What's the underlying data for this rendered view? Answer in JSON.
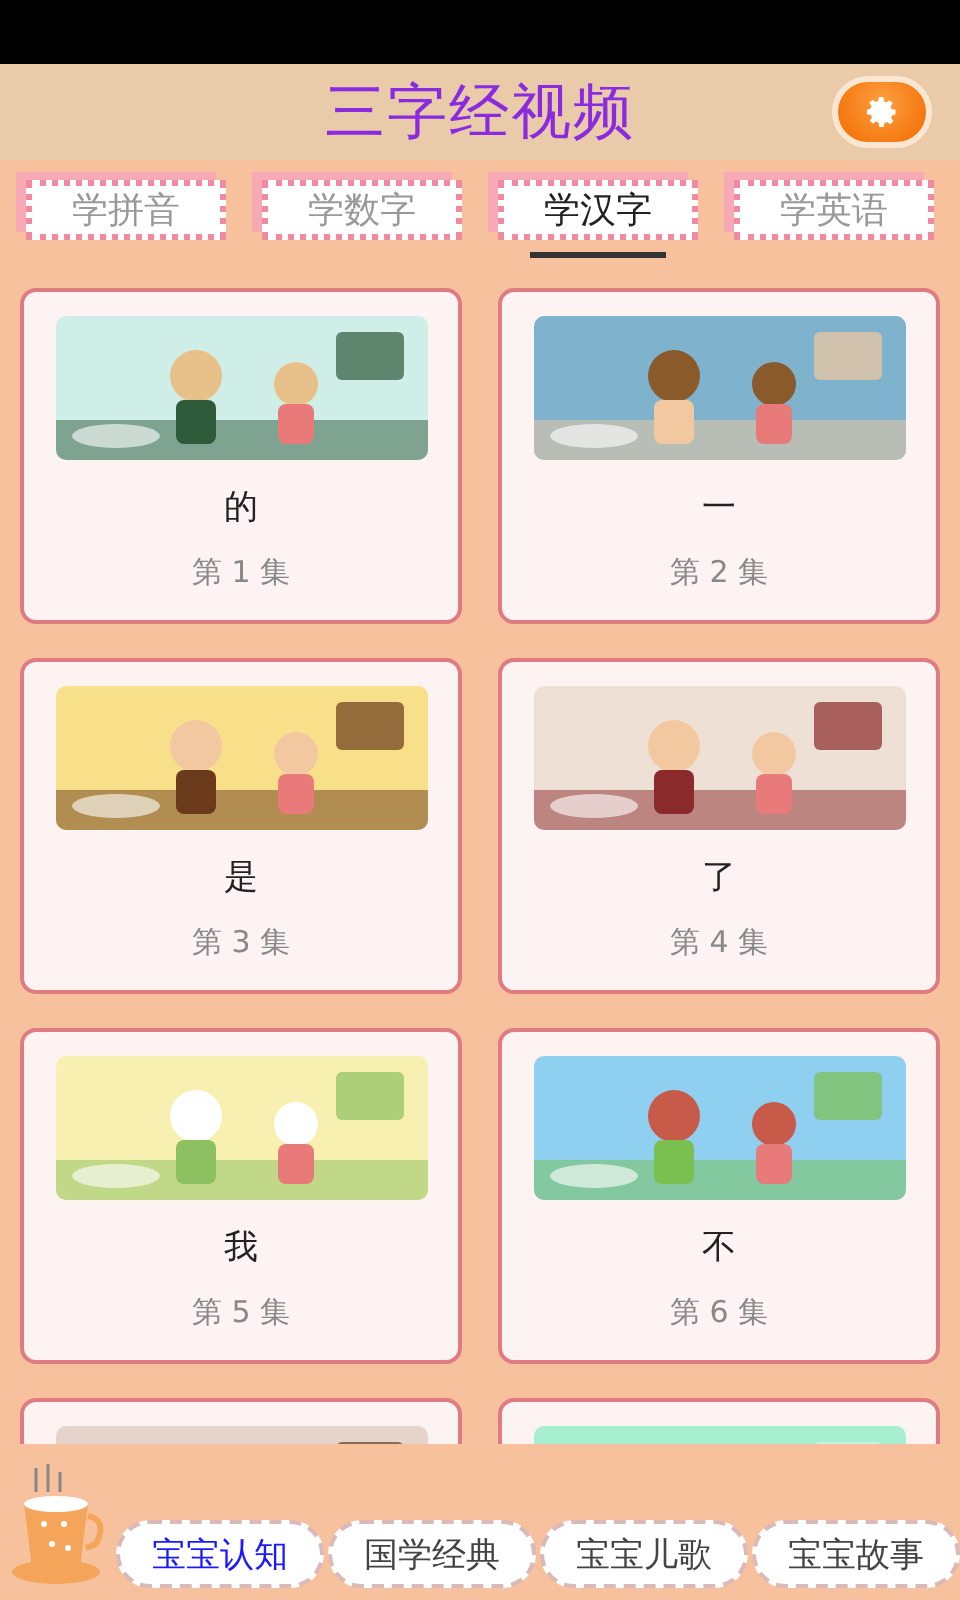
{
  "header": {
    "title": "三字经视频"
  },
  "tabs": [
    {
      "label": "学拼音",
      "selected": false
    },
    {
      "label": "学数字",
      "selected": false
    },
    {
      "label": "学汉字",
      "selected": true
    },
    {
      "label": "学英语",
      "selected": false
    }
  ],
  "videos": [
    {
      "kind": "video",
      "title": "的",
      "episode": "第 1 集"
    },
    {
      "kind": "video",
      "title": "一",
      "episode": "第 2 集"
    },
    {
      "kind": "video",
      "title": "是",
      "episode": "第 3 集"
    },
    {
      "kind": "video",
      "title": "了",
      "episode": "第 4 集"
    },
    {
      "kind": "video",
      "title": "我",
      "episode": "第 5 集"
    },
    {
      "kind": "video",
      "title": "不",
      "episode": "第 6 集"
    },
    {
      "kind": "partial"
    },
    {
      "kind": "partial"
    }
  ],
  "bottom_nav": [
    {
      "label": "宝宝认知",
      "selected": true
    },
    {
      "label": "国学经典",
      "selected": false
    },
    {
      "label": "宝宝儿歌",
      "selected": false
    },
    {
      "label": "宝宝故事",
      "selected": false
    }
  ]
}
